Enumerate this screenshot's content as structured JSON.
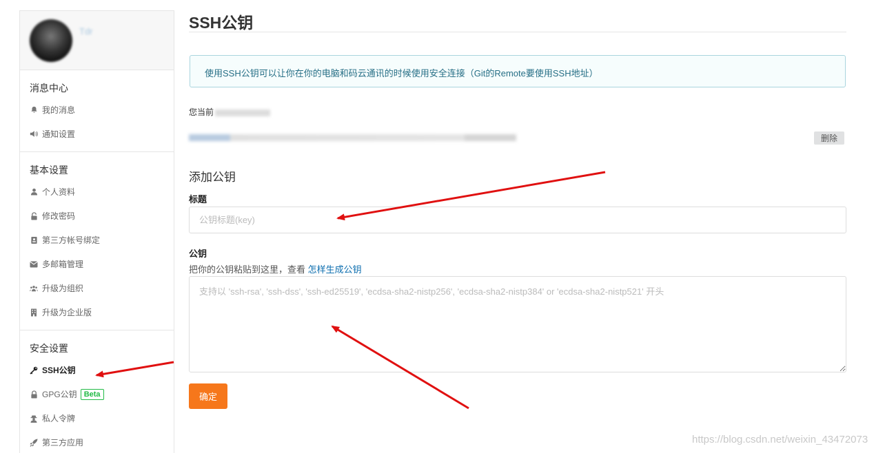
{
  "sidebar": {
    "username": "Tdr",
    "groups": [
      {
        "title": "消息中心",
        "items": [
          {
            "label": "我的消息",
            "icon": "bell-icon"
          },
          {
            "label": "通知设置",
            "icon": "speaker-icon"
          }
        ]
      },
      {
        "title": "基本设置",
        "items": [
          {
            "label": "个人资料",
            "icon": "user-icon"
          },
          {
            "label": "修改密码",
            "icon": "unlock-icon"
          },
          {
            "label": "第三方帐号绑定",
            "icon": "id-card-icon"
          },
          {
            "label": "多邮箱管理",
            "icon": "envelope-icon"
          },
          {
            "label": "升级为组织",
            "icon": "users-icon"
          },
          {
            "label": "升级为企业版",
            "icon": "building-icon"
          }
        ]
      },
      {
        "title": "安全设置",
        "items": [
          {
            "label": "SSH公钥",
            "icon": "key-icon",
            "active": true
          },
          {
            "label": "GPG公钥",
            "icon": "lock-icon",
            "badge": "Beta"
          },
          {
            "label": "私人令牌",
            "icon": "user-secret-icon"
          },
          {
            "label": "第三方应用",
            "icon": "rocket-icon"
          }
        ]
      }
    ]
  },
  "main": {
    "title": "SSH公钥",
    "info": "使用SSH公钥可以让你在你的电脑和码云通讯的时候使用安全连接（Git的Remote要使用SSH地址）",
    "current_label": "您当前",
    "delete_label": "删除",
    "add_section_title": "添加公钥",
    "title_field": {
      "label": "标题",
      "placeholder": "公钥标题(key)"
    },
    "key_field": {
      "label": "公钥",
      "hint": "把你的公钥粘贴到这里，查看",
      "hint_link": "怎样生成公钥",
      "placeholder": "支持以 'ssh-rsa', 'ssh-dss', 'ssh-ed25519', 'ecdsa-sha2-nistp256', 'ecdsa-sha2-nistp384' or 'ecdsa-sha2-nistp521' 开头"
    },
    "submit_label": "确定"
  },
  "watermark": "https://blog.csdn.net/weixin_43472073",
  "colors": {
    "accent": "#f6771b",
    "info_bg": "#f6fdfd",
    "info_border": "#a9d5de",
    "info_text": "#276f86",
    "link": "#0d6eaf",
    "annotation_arrow": "#e01010"
  }
}
